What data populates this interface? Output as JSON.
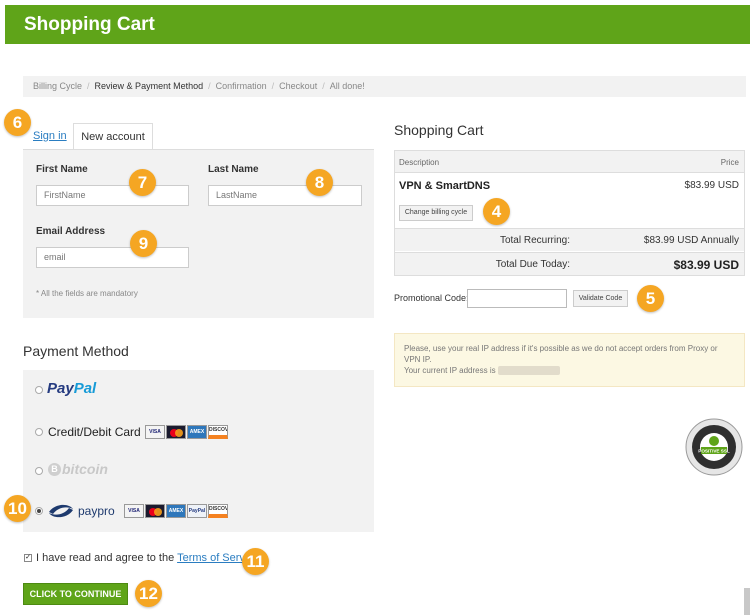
{
  "header": {
    "title": "Shopping Cart",
    "color": "#5fa419"
  },
  "breadcrumb": {
    "items": [
      "Billing Cycle",
      "Review & Payment Method",
      "Confirmation",
      "Checkout",
      "All done!"
    ],
    "active_index": 1,
    "separator": "/"
  },
  "annotations": [
    "6",
    "7",
    "8",
    "9",
    "4",
    "5",
    "10",
    "11",
    "12"
  ],
  "account": {
    "tabs": {
      "signin": "Sign in",
      "new_account": "New account"
    },
    "first_name": {
      "label": "First Name",
      "placeholder": "FirstName"
    },
    "last_name": {
      "label": "Last Name",
      "placeholder": "LastName"
    },
    "email": {
      "label": "Email Address",
      "placeholder": "email"
    },
    "mandatory_note": "* All the fields are mandatory"
  },
  "payment": {
    "heading": "Payment Method",
    "methods": {
      "paypal": {
        "part1": "Pay",
        "part2": "Pal",
        "icon": "paypal-logo"
      },
      "card": {
        "label": "Credit/Debit Card"
      },
      "bitcoin": {
        "coin": "B",
        "label": "bitcoin"
      },
      "paypro": {
        "label": "paypro",
        "icon": "paypro-logo"
      }
    },
    "selected": "paypro",
    "card_logos": [
      "VISA",
      "MC",
      "AMEX",
      "DISCOVER"
    ],
    "paypro_logos": [
      "VISA",
      "MC",
      "AMEX",
      "PayPal",
      "DISCOVER"
    ]
  },
  "terms": {
    "checked": true,
    "text": "I have read and agree to the",
    "link": "Terms of Service"
  },
  "continue_button": "CLICK TO CONTINUE",
  "cart": {
    "heading": "Shopping Cart",
    "columns": {
      "description": "Description",
      "price": "Price"
    },
    "product": {
      "name": "VPN & SmartDNS",
      "price": "$83.99 USD"
    },
    "change_billing": "Change billing cycle",
    "total_recurring": {
      "label": "Total Recurring:",
      "value": "$83.99 USD Annually"
    },
    "total_due": {
      "label": "Total Due Today:",
      "value": "$83.99 USD"
    }
  },
  "promo": {
    "label": "Promotional Code:",
    "button": "Validate Code"
  },
  "notice": {
    "line1": "Please, use your real IP address if it's possible as we do not accept orders from Proxy or VPN IP.",
    "line2": "Your current IP address is"
  },
  "ssl_seal": {
    "text": "POSITIVE SSL",
    "icon": "positive-ssl-seal"
  }
}
